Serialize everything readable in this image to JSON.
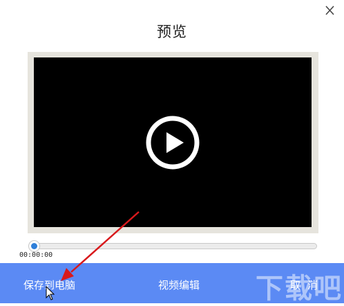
{
  "dialog": {
    "title": "预览",
    "close_icon": "close-icon"
  },
  "player": {
    "play_icon": "play-icon",
    "current_time": "00:00:00",
    "progress": 0.0,
    "accent_color": "#2f7fd9"
  },
  "actions": {
    "save_label": "保存到电脑",
    "edit_label": "视频编辑",
    "cancel_label": "取消",
    "bar_color": "#5b8af4"
  },
  "watermark": {
    "text": "下载吧"
  },
  "annotation": {
    "arrow_color": "#d8191c"
  }
}
